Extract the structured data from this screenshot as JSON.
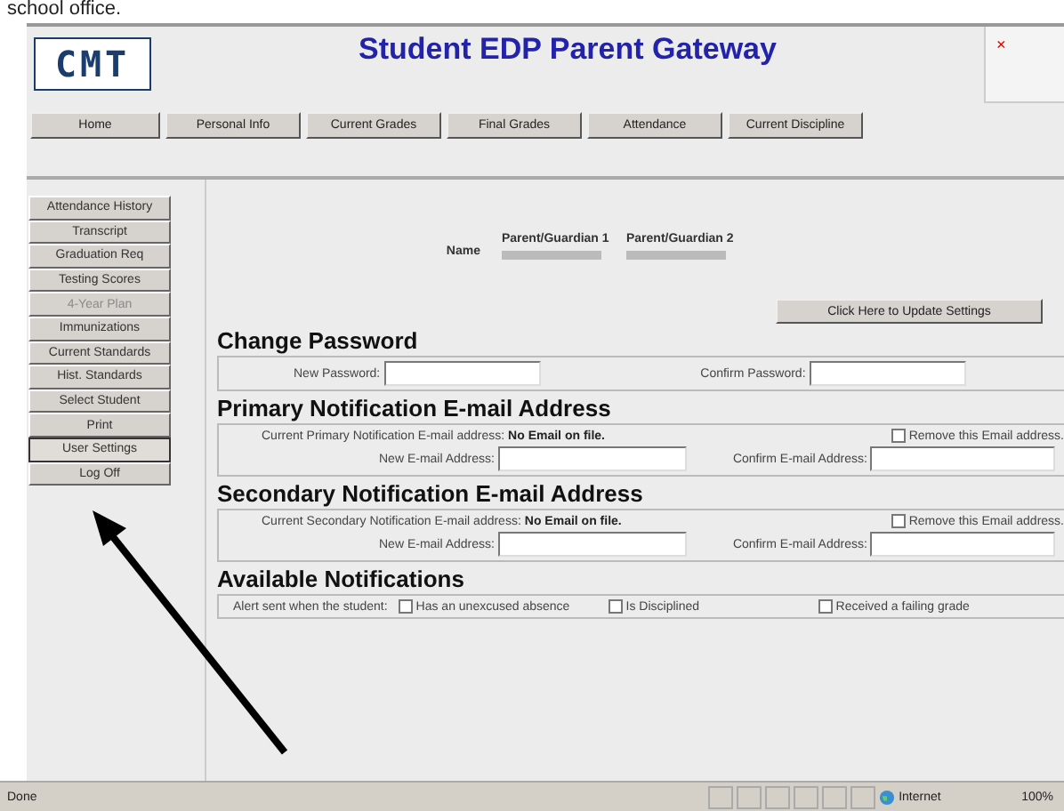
{
  "caption": "school office.",
  "header": {
    "logo": "CMT",
    "title": "Student EDP Parent Gateway",
    "close": "×"
  },
  "nav": [
    {
      "label": "Home"
    },
    {
      "label": "Personal Info"
    },
    {
      "label": "Current Grades"
    },
    {
      "label": "Final Grades"
    },
    {
      "label": "Attendance"
    },
    {
      "label": "Current Discipline"
    }
  ],
  "sidebar": {
    "items": [
      {
        "label": "Attendance History",
        "disabled": false,
        "selected": false
      },
      {
        "label": "Transcript",
        "disabled": false,
        "selected": false
      },
      {
        "label": "Graduation Req",
        "disabled": false,
        "selected": false
      },
      {
        "label": "Testing Scores",
        "disabled": false,
        "selected": false
      },
      {
        "label": "4-Year Plan",
        "disabled": true,
        "selected": false
      },
      {
        "label": "Immunizations",
        "disabled": false,
        "selected": false
      },
      {
        "label": "Current Standards",
        "disabled": false,
        "selected": false
      },
      {
        "label": "Hist. Standards",
        "disabled": false,
        "selected": false
      },
      {
        "label": "Select Student",
        "disabled": false,
        "selected": false
      },
      {
        "label": "Print",
        "disabled": false,
        "selected": false
      },
      {
        "label": "User Settings",
        "disabled": false,
        "selected": true
      },
      {
        "label": "Log Off",
        "disabled": false,
        "selected": false
      }
    ]
  },
  "guardians": {
    "label": "Name",
    "columns": [
      "Parent/Guardian 1",
      "Parent/Guardian 2"
    ]
  },
  "update_button": "Click Here to Update Settings",
  "change_password": {
    "heading": "Change Password",
    "new_label": "New Password:",
    "confirm_label": "Confirm Password:"
  },
  "primary": {
    "heading": "Primary Notification E-mail Address",
    "current_label": "Current Primary Notification E-mail address:",
    "current_value": "No Email on file.",
    "remove": {
      "label": "Remove this Email address.",
      "checked": false
    },
    "new_label": "New E-mail Address:",
    "confirm_label": "Confirm E-mail Address:"
  },
  "secondary": {
    "heading": "Secondary Notification E-mail Address",
    "current_label": "Current Secondary Notification E-mail address:",
    "current_value": "No Email on file.",
    "remove": {
      "label": "Remove this Email address.",
      "checked": false
    },
    "new_label": "New E-mail Address:",
    "confirm_label": "Confirm E-mail Address:"
  },
  "notifications": {
    "heading": "Available Notifications",
    "label": "Alert sent when the student:",
    "options": [
      {
        "label": "Has an unexcused absence",
        "checked": false
      },
      {
        "label": "Is Disciplined",
        "checked": false
      },
      {
        "label": "Received a failing grade",
        "checked": false
      }
    ]
  },
  "status_bar": {
    "text": "Done",
    "zone": "Internet",
    "zoom": "100%"
  }
}
